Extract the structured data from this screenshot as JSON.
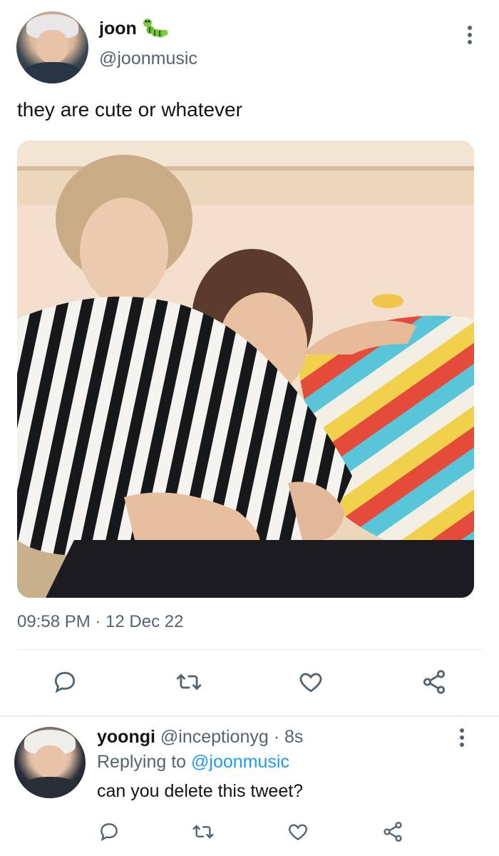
{
  "tweet": {
    "author": {
      "name": "joon",
      "handle": "@joonmusic",
      "badge_icon": "caterpillar-emoji"
    },
    "text": "they are cute or whatever",
    "timestamp": "09:58 PM · 12 Dec 22",
    "actions": [
      "reply-icon",
      "retweet-icon",
      "like-icon",
      "share-icon"
    ]
  },
  "reply": {
    "author": {
      "name": "yoongi",
      "handle": "@inceptionyg",
      "time": "· 8s"
    },
    "replying_prefix": "Replying to",
    "replying_to": "@joonmusic",
    "text": "can you delete this tweet?",
    "actions": [
      "reply-icon",
      "retweet-icon",
      "like-icon",
      "share-icon"
    ]
  },
  "colors": {
    "text": "#0f1419",
    "secondary": "#536471",
    "link": "#1d9bf0",
    "divider": "#e6ecf0"
  }
}
